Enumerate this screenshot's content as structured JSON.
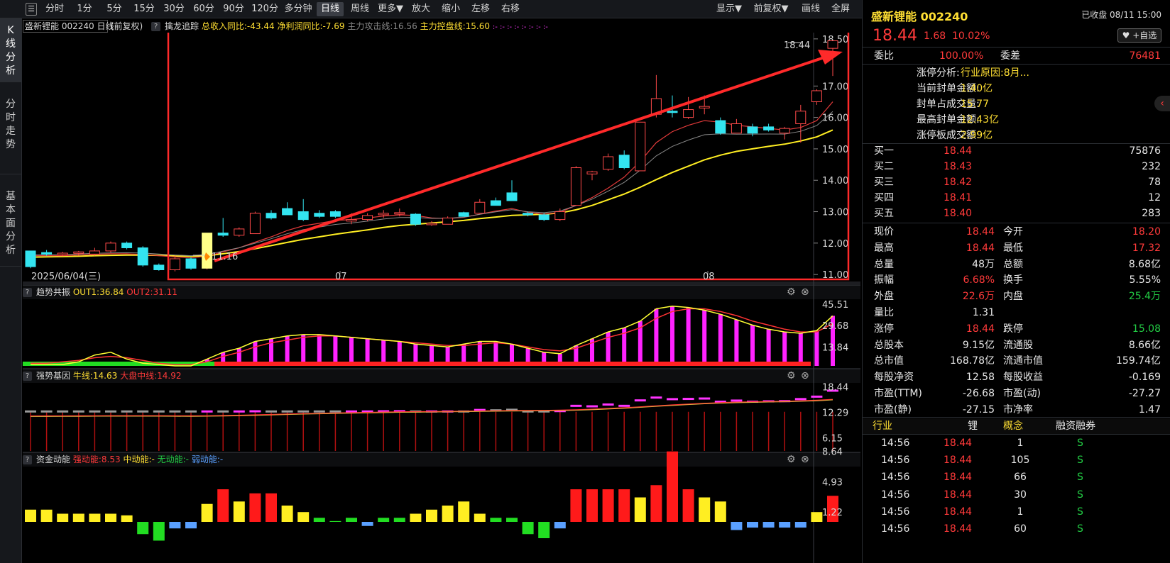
{
  "toolbar": {
    "periods": [
      "分时",
      "1分",
      "5分",
      "15分",
      "30分",
      "60分",
      "90分",
      "120分",
      "多分钟",
      "日线",
      "周线",
      "更多▼",
      "放大",
      "缩小",
      "左移",
      "右移"
    ],
    "active_period": "日线",
    "right_buttons": [
      "显示▼",
      "前复权▼",
      "画线",
      "全屏"
    ]
  },
  "vtabs": [
    "K线分析",
    "分时走势",
    "基本面分析"
  ],
  "main_panel": {
    "title": "盛新锂能 002240 日线",
    "adjust": "(前复权)",
    "indicator_name": "擒龙追踪",
    "ind1": "总收入同比:-43.44",
    "ind2": "净利润同比:-7.69",
    "ind3": "主力攻击线:16.56",
    "ind4": "主力控盘线:15.60",
    "dashes": ":- :- :- :- :- :- :- :-",
    "price_labels": [
      "18.50",
      "17.00",
      "16.00",
      "15.00",
      "14.00",
      "13.00",
      "12.00",
      "11.00"
    ],
    "date_label": "2025/06/04(三)",
    "month_labels": [
      "07",
      "08"
    ],
    "high_marker": "18.44",
    "low_marker": "11.16"
  },
  "trend_panel": {
    "title": "趋势共振",
    "out1": "OUT1:36.84",
    "out2": "OUT2:31.11",
    "axis": [
      "45.51",
      "29.68",
      "13.84"
    ]
  },
  "strong_panel": {
    "title": "强势基因",
    "bull": "牛线:14.63",
    "market": "大盘中线:14.92",
    "axis": [
      "18.44",
      "12.29",
      "6.15"
    ]
  },
  "fund_panel": {
    "title": "资金动能",
    "strong": "强动能:8.53",
    "mid": "中动能:-",
    "none": "无动能:-",
    "weak": "弱动能:-",
    "axis": [
      "8.64",
      "4.93",
      "1.22"
    ]
  },
  "quote": {
    "name": "盛新锂能 002240",
    "status": "已收盘 08/11 15:00",
    "price": "18.44",
    "change": "1.68",
    "change_pct": "10.02%",
    "watch_btn": "♥ +自选",
    "weibi_label": "委比",
    "weibi": "100.00%",
    "weicha_label": "委差",
    "weicha": "76481",
    "limit_info": [
      {
        "label": "涨停分析:",
        "value": "行业原因:8月..."
      },
      {
        "label": "当前封单金额:",
        "value": "1.40亿"
      },
      {
        "label": "封单占成交量:",
        "value": "15.77"
      },
      {
        "label": "最高封单金额:",
        "value": "12.43亿"
      },
      {
        "label": "涨停板成交额:",
        "value": "2.99亿"
      }
    ],
    "bids": [
      {
        "label": "买一",
        "price": "18.44",
        "vol": "75876"
      },
      {
        "label": "买二",
        "price": "18.43",
        "vol": "232"
      },
      {
        "label": "买三",
        "price": "18.42",
        "vol": "78"
      },
      {
        "label": "买四",
        "price": "18.41",
        "vol": "12"
      },
      {
        "label": "买五",
        "price": "18.40",
        "vol": "283"
      }
    ],
    "stats": [
      {
        "l1": "现价",
        "v1": "18.44",
        "c1": "red",
        "l2": "今开",
        "v2": "18.20",
        "c2": "red"
      },
      {
        "l1": "最高",
        "v1": "18.44",
        "c1": "red",
        "l2": "最低",
        "v2": "17.32",
        "c2": "red"
      },
      {
        "l1": "总量",
        "v1": "48万",
        "c1": "white",
        "l2": "总额",
        "v2": "8.68亿",
        "c2": "white"
      },
      {
        "l1": "振幅",
        "v1": "6.68%",
        "c1": "red",
        "l2": "换手",
        "v2": "5.55%",
        "c2": "white"
      },
      {
        "l1": "外盘",
        "v1": "22.6万",
        "c1": "red",
        "l2": "内盘",
        "v2": "25.4万",
        "c2": "green"
      },
      {
        "l1": "量比",
        "v1": "1.31",
        "c1": "white",
        "l2": "",
        "v2": "",
        "c2": "white"
      },
      {
        "l1": "涨停",
        "v1": "18.44",
        "c1": "red",
        "l2": "跌停",
        "v2": "15.08",
        "c2": "green"
      },
      {
        "l1": "总股本",
        "v1": "9.15亿",
        "c1": "white",
        "l2": "流通股",
        "v2": "8.66亿",
        "c2": "white"
      },
      {
        "l1": "总市值",
        "v1": "168.78亿",
        "c1": "white",
        "l2": "流通市值",
        "v2": "159.74亿",
        "c2": "white"
      },
      {
        "l1": "每股净资",
        "v1": "12.58",
        "c1": "white",
        "l2": "每股收益",
        "v2": "-0.169",
        "c2": "white"
      },
      {
        "l1": "市盈(TTM)",
        "v1": "-26.68",
        "c1": "white",
        "l2": "市盈(动)",
        "v2": "-27.27",
        "c2": "white"
      },
      {
        "l1": "市盈(静)",
        "v1": "-27.15",
        "c1": "white",
        "l2": "市净率",
        "v2": "1.47",
        "c2": "white"
      }
    ],
    "bottom_tabs": [
      "行业",
      "锂",
      "概念",
      "融资融券"
    ],
    "ticks": [
      {
        "time": "14:56",
        "price": "18.44",
        "vol": "1",
        "flag": "S"
      },
      {
        "time": "14:56",
        "price": "18.44",
        "vol": "105",
        "flag": "S"
      },
      {
        "time": "14:56",
        "price": "18.44",
        "vol": "66",
        "flag": "S"
      },
      {
        "time": "14:56",
        "price": "18.44",
        "vol": "30",
        "flag": "S"
      },
      {
        "time": "14:56",
        "price": "18.44",
        "vol": "1",
        "flag": "S"
      },
      {
        "time": "14:56",
        "price": "18.44",
        "vol": "60",
        "flag": "S"
      }
    ]
  },
  "chart_data": {
    "type": "candlestick",
    "ylim": [
      10.8,
      18.7
    ],
    "candles": [
      {
        "o": 11.75,
        "h": 11.75,
        "l": 11.2,
        "c": 11.25
      },
      {
        "o": 11.7,
        "h": 11.78,
        "l": 11.6,
        "c": 11.65
      },
      {
        "o": 11.65,
        "h": 11.72,
        "l": 11.6,
        "c": 11.68
      },
      {
        "o": 11.68,
        "h": 11.75,
        "l": 11.6,
        "c": 11.72
      },
      {
        "o": 11.65,
        "h": 11.85,
        "l": 11.6,
        "c": 11.75
      },
      {
        "o": 11.75,
        "h": 12.05,
        "l": 11.7,
        "c": 12.0
      },
      {
        "o": 12.0,
        "h": 12.05,
        "l": 11.8,
        "c": 11.85
      },
      {
        "o": 11.85,
        "h": 11.9,
        "l": 11.25,
        "c": 11.3
      },
      {
        "o": 11.3,
        "h": 11.35,
        "l": 11.12,
        "c": 11.15
      },
      {
        "o": 11.15,
        "h": 11.6,
        "l": 11.1,
        "c": 11.5
      },
      {
        "o": 11.5,
        "h": 11.55,
        "l": 11.15,
        "c": 11.2
      },
      {
        "o": 11.2,
        "h": 12.32,
        "l": 11.16,
        "c": 12.32
      },
      {
        "o": 12.32,
        "h": 12.8,
        "l": 12.2,
        "c": 12.25
      },
      {
        "o": 12.25,
        "h": 12.5,
        "l": 12.2,
        "c": 12.45
      },
      {
        "o": 12.3,
        "h": 13.0,
        "l": 12.3,
        "c": 12.95
      },
      {
        "o": 12.95,
        "h": 13.05,
        "l": 12.75,
        "c": 12.8
      },
      {
        "o": 13.1,
        "h": 13.3,
        "l": 12.9,
        "c": 12.9
      },
      {
        "o": 13.0,
        "h": 13.4,
        "l": 12.7,
        "c": 12.75
      },
      {
        "o": 12.95,
        "h": 13.05,
        "l": 12.8,
        "c": 12.85
      },
      {
        "o": 13.0,
        "h": 13.05,
        "l": 12.8,
        "c": 12.85
      },
      {
        "o": 12.7,
        "h": 12.95,
        "l": 12.6,
        "c": 12.75
      },
      {
        "o": 12.75,
        "h": 12.95,
        "l": 12.7,
        "c": 12.88
      },
      {
        "o": 12.9,
        "h": 13.05,
        "l": 12.8,
        "c": 12.95
      },
      {
        "o": 12.95,
        "h": 13.1,
        "l": 12.85,
        "c": 12.97
      },
      {
        "o": 12.92,
        "h": 12.95,
        "l": 12.55,
        "c": 12.6
      },
      {
        "o": 12.6,
        "h": 12.7,
        "l": 12.55,
        "c": 12.63
      },
      {
        "o": 12.6,
        "h": 12.85,
        "l": 12.6,
        "c": 12.8
      },
      {
        "o": 12.97,
        "h": 13.0,
        "l": 12.85,
        "c": 12.85
      },
      {
        "o": 12.95,
        "h": 13.4,
        "l": 12.95,
        "c": 13.3
      },
      {
        "o": 13.35,
        "h": 13.45,
        "l": 13.2,
        "c": 13.2
      },
      {
        "o": 13.6,
        "h": 14.0,
        "l": 13.4,
        "c": 13.35
      },
      {
        "o": 12.95,
        "h": 13.0,
        "l": 12.85,
        "c": 12.9
      },
      {
        "o": 12.9,
        "h": 12.95,
        "l": 12.7,
        "c": 12.75
      },
      {
        "o": 12.75,
        "h": 13.1,
        "l": 12.7,
        "c": 13.0
      },
      {
        "o": 13.2,
        "h": 14.45,
        "l": 13.2,
        "c": 14.4
      },
      {
        "o": 14.2,
        "h": 14.3,
        "l": 14.0,
        "c": 14.27
      },
      {
        "o": 14.35,
        "h": 14.85,
        "l": 14.3,
        "c": 14.75
      },
      {
        "o": 14.8,
        "h": 14.95,
        "l": 14.35,
        "c": 14.4
      },
      {
        "o": 14.3,
        "h": 15.85,
        "l": 14.3,
        "c": 15.85
      },
      {
        "o": 16.1,
        "h": 17.35,
        "l": 16.0,
        "c": 16.6
      },
      {
        "o": 16.2,
        "h": 16.7,
        "l": 16.0,
        "c": 16.18
      },
      {
        "o": 16.0,
        "h": 16.65,
        "l": 15.95,
        "c": 16.25
      },
      {
        "o": 16.3,
        "h": 16.7,
        "l": 16.1,
        "c": 16.35
      },
      {
        "o": 15.9,
        "h": 16.0,
        "l": 15.45,
        "c": 15.5
      },
      {
        "o": 15.5,
        "h": 15.95,
        "l": 15.5,
        "c": 15.8
      },
      {
        "o": 15.7,
        "h": 15.8,
        "l": 15.4,
        "c": 15.5
      },
      {
        "o": 15.7,
        "h": 15.8,
        "l": 15.55,
        "c": 15.6
      },
      {
        "o": 15.5,
        "h": 15.7,
        "l": 15.3,
        "c": 15.65
      },
      {
        "o": 15.8,
        "h": 16.4,
        "l": 15.2,
        "c": 16.2
      },
      {
        "o": 16.5,
        "h": 16.9,
        "l": 16.4,
        "c": 16.85
      },
      {
        "o": 18.2,
        "h": 18.44,
        "l": 17.32,
        "c": 18.44
      }
    ],
    "ma_fast": [
      11.6,
      11.6,
      11.6,
      11.62,
      11.64,
      11.66,
      11.66,
      11.64,
      11.6,
      11.56,
      11.53,
      11.58,
      11.72,
      11.85,
      12.03,
      12.2,
      12.4,
      12.55,
      12.63,
      12.72,
      12.75,
      12.8,
      12.86,
      12.9,
      12.88,
      12.8,
      12.78,
      12.82,
      12.92,
      13.02,
      13.1,
      12.98,
      12.92,
      12.98,
      13.2,
      13.45,
      13.75,
      14.1,
      14.6,
      15.2,
      15.55,
      15.75,
      15.9,
      15.85,
      15.75,
      15.7,
      15.65,
      15.6,
      15.68,
      15.9,
      16.5
    ],
    "ma_slow": [
      11.55,
      11.56,
      11.57,
      11.58,
      11.6,
      11.61,
      11.62,
      11.62,
      11.61,
      11.59,
      11.58,
      11.6,
      11.66,
      11.73,
      11.82,
      11.92,
      12.02,
      12.12,
      12.2,
      12.28,
      12.35,
      12.42,
      12.5,
      12.56,
      12.6,
      12.64,
      12.68,
      12.72,
      12.78,
      12.83,
      12.88,
      12.9,
      12.92,
      12.96,
      13.06,
      13.2,
      13.38,
      13.56,
      13.78,
      14.02,
      14.25,
      14.45,
      14.65,
      14.8,
      14.92,
      15.0,
      15.08,
      15.15,
      15.25,
      15.38,
      15.6
    ],
    "trend_out1": [
      1,
      1,
      1,
      3,
      8,
      10,
      5,
      2,
      1,
      0,
      0,
      5,
      10,
      13,
      18,
      20,
      22,
      23,
      23,
      22,
      21,
      20,
      19,
      18,
      16,
      15,
      14,
      16,
      18,
      18,
      16,
      13,
      10,
      9,
      15,
      20,
      25,
      28,
      33,
      42,
      44,
      43,
      41,
      38,
      34,
      30,
      27,
      25,
      24,
      26,
      36.84
    ],
    "trend_out2": [
      2,
      2,
      3,
      4,
      6,
      7,
      6,
      4,
      2,
      1,
      1,
      3,
      7,
      10,
      14,
      17,
      19,
      21,
      22,
      22,
      21,
      20,
      19,
      18,
      17,
      16,
      15,
      15,
      16,
      17,
      16,
      14,
      12,
      11,
      13,
      17,
      21,
      24,
      28,
      35,
      40,
      42,
      42,
      40,
      37,
      33,
      30,
      27,
      25,
      25,
      31.11
    ],
    "fund": [
      1.5,
      1.5,
      1.0,
      1.0,
      1.0,
      1.0,
      0.8,
      -1.5,
      -2.3,
      -0.8,
      -0.8,
      2.2,
      4.0,
      2.5,
      3.5,
      3.5,
      2.0,
      1.2,
      0.5,
      0.1,
      0.5,
      -0.5,
      0.5,
      0.5,
      1.0,
      1.5,
      2.0,
      2.5,
      1.0,
      0.5,
      0.5,
      -1.5,
      -2.0,
      -0.8,
      4.0,
      4.0,
      4.0,
      4.0,
      3.0,
      4.5,
      8.64,
      4.0,
      3.0,
      2.5,
      -1.0,
      -0.7,
      -0.7,
      -0.7,
      -0.7,
      1.2,
      3.2,
      8.53
    ]
  }
}
